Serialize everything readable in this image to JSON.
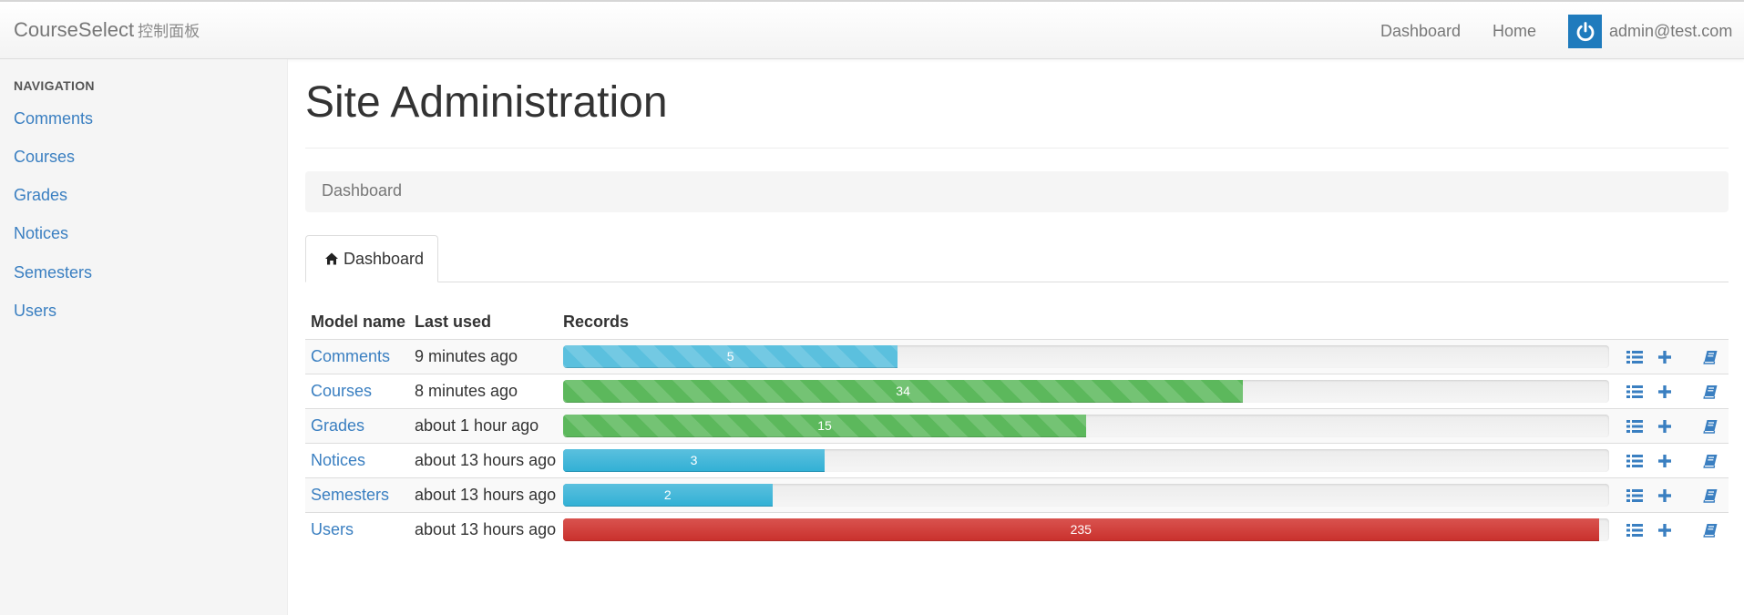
{
  "navbar": {
    "brand_name": "CourseSelect",
    "brand_subtitle": "控制面板",
    "links": [
      "Dashboard",
      "Home"
    ],
    "user_email": "admin@test.com"
  },
  "sidebar": {
    "header": "NAVIGATION",
    "items": [
      "Comments",
      "Courses",
      "Grades",
      "Notices",
      "Semesters",
      "Users"
    ]
  },
  "main": {
    "title": "Site Administration",
    "breadcrumb": "Dashboard",
    "tab_label": "Dashboard",
    "table": {
      "headers": [
        "Model name",
        "Last used",
        "Records"
      ],
      "rows": [
        {
          "model": "Comments",
          "last_used": "9 minutes ago",
          "records": "5",
          "bar_percent": 32,
          "bar_style": "info-striped"
        },
        {
          "model": "Courses",
          "last_used": "8 minutes ago",
          "records": "34",
          "bar_percent": 65,
          "bar_style": "success-striped"
        },
        {
          "model": "Grades",
          "last_used": "about 1 hour ago",
          "records": "15",
          "bar_percent": 50,
          "bar_style": "success-striped"
        },
        {
          "model": "Notices",
          "last_used": "about 13 hours ago",
          "records": "3",
          "bar_percent": 25,
          "bar_style": "info"
        },
        {
          "model": "Semesters",
          "last_used": "about 13 hours ago",
          "records": "2",
          "bar_percent": 20,
          "bar_style": "info"
        },
        {
          "model": "Users",
          "last_used": "about 13 hours ago",
          "records": "235",
          "bar_percent": 99,
          "bar_style": "danger"
        }
      ],
      "row_actions": [
        "list-icon",
        "plus-icon",
        "book-icon"
      ]
    }
  },
  "colors": {
    "link": "#3a7fc1",
    "avatar": "#1f7bbd",
    "info": "#5bc0de",
    "success": "#5cb85c",
    "danger": "#d9534f"
  }
}
